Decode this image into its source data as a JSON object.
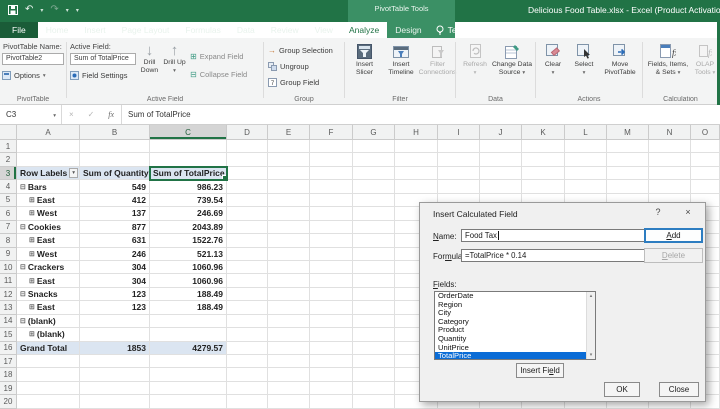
{
  "titlebar": {
    "title": "Delicious Food Table.xlsx - Excel (Product Activation Fa",
    "contextual_label": "PivotTable Tools"
  },
  "tabs": {
    "items": [
      "File",
      "Home",
      "Insert",
      "Page Layout",
      "Formulas",
      "Data",
      "Review",
      "View",
      "Analyze",
      "Design"
    ],
    "active": "Analyze",
    "tellme": "Tell me what you want to do..."
  },
  "ribbon": {
    "pivottable": {
      "name_label": "PivotTable Name:",
      "name_value": "PivotTable2",
      "options": "Options",
      "group_label": "PivotTable"
    },
    "active_field": {
      "label": "Active Field:",
      "value": "Sum of TotalPrice",
      "field_settings": "Field Settings",
      "drill_down": "Drill Down",
      "drill_up": "Drill Up",
      "expand": "Expand Field",
      "collapse": "Collapse Field",
      "group_label": "Active Field"
    },
    "group": {
      "selection": "Group Selection",
      "ungroup": "Ungroup",
      "field": "Group Field",
      "group_label": "Group"
    },
    "filter": {
      "slicer_1": "Insert",
      "slicer_2": "Slicer",
      "timeline_1": "Insert",
      "timeline_2": "Timeline",
      "connections_1": "Filter",
      "connections_2": "Connections",
      "group_label": "Filter"
    },
    "data": {
      "refresh": "Refresh",
      "change_1": "Change Data",
      "change_2": "Source",
      "group_label": "Data"
    },
    "actions": {
      "clear": "Clear",
      "select": "Select",
      "move_1": "Move",
      "move_2": "PivotTable",
      "group_label": "Actions"
    },
    "calculations": {
      "fields_1": "Fields, Items,",
      "fields_2": "& Sets",
      "olap_1": "OLAP",
      "olap_2": "Tools",
      "group_label": "Calculation"
    }
  },
  "formula_bar": {
    "cell_ref": "C3",
    "formula": "Sum of TotalPrice",
    "fx": "fx",
    "cancel": "×",
    "enter": "✓"
  },
  "sheet": {
    "columns": [
      "A",
      "B",
      "C",
      "D",
      "E",
      "F",
      "G",
      "H",
      "I",
      "J",
      "K",
      "L",
      "M",
      "N",
      "O"
    ],
    "row_count": 20,
    "pivot": {
      "header": {
        "row": 3,
        "row_labels": "Row Labels",
        "col_qty": "Sum of Quantity",
        "col_total": "Sum of TotalPrice"
      },
      "selected_cell": "C3",
      "rows": [
        {
          "row": 4,
          "label": "Bars",
          "expand": "minus",
          "level": 0,
          "qty": "549",
          "total": "986.23"
        },
        {
          "row": 5,
          "label": "East",
          "expand": "plus",
          "level": 1,
          "qty": "412",
          "total": "739.54"
        },
        {
          "row": 6,
          "label": "West",
          "expand": "plus",
          "level": 1,
          "qty": "137",
          "total": "246.69"
        },
        {
          "row": 7,
          "label": "Cookies",
          "expand": "minus",
          "level": 0,
          "qty": "877",
          "total": "2043.89"
        },
        {
          "row": 8,
          "label": "East",
          "expand": "plus",
          "level": 1,
          "qty": "631",
          "total": "1522.76"
        },
        {
          "row": 9,
          "label": "West",
          "expand": "plus",
          "level": 1,
          "qty": "246",
          "total": "521.13"
        },
        {
          "row": 10,
          "label": "Crackers",
          "expand": "minus",
          "level": 0,
          "qty": "304",
          "total": "1060.96"
        },
        {
          "row": 11,
          "label": "East",
          "expand": "plus",
          "level": 1,
          "qty": "304",
          "total": "1060.96"
        },
        {
          "row": 12,
          "label": "Snacks",
          "expand": "minus",
          "level": 0,
          "qty": "123",
          "total": "188.49"
        },
        {
          "row": 13,
          "label": "East",
          "expand": "plus",
          "level": 1,
          "qty": "123",
          "total": "188.49"
        },
        {
          "row": 14,
          "label": "(blank)",
          "expand": "minus",
          "level": 0,
          "qty": "",
          "total": ""
        },
        {
          "row": 15,
          "label": "(blank)",
          "expand": "plus",
          "level": 1,
          "qty": "",
          "total": ""
        },
        {
          "row": 16,
          "label": "Grand Total",
          "expand": "",
          "level": 0,
          "qty": "1853",
          "total": "4279.57",
          "type": "total"
        }
      ]
    }
  },
  "dialog": {
    "title": "Insert Calculated Field",
    "help": "?",
    "close_x": "×",
    "name_label": "Name:",
    "name_value": "Food Tax",
    "formula_label": "Formula:",
    "formula_value": "=TotalPrice * 0.14",
    "fields_label": "Fields:",
    "fields": [
      "OrderDate",
      "Region",
      "City",
      "Category",
      "Product",
      "Quantity",
      "UnitPrice",
      "TotalPrice"
    ],
    "selected_field": "TotalPrice",
    "add_button": "Add",
    "delete_button": "Delete",
    "insert_field_button": "Insert Field",
    "ok_button": "OK",
    "close_button": "Close"
  },
  "icons": {
    "dropdown": "▾",
    "drill_down": "↓",
    "drill_up": "↑",
    "undo": "↶",
    "redo": "↷",
    "expand_box": "⊞",
    "collapse_box": "⊟",
    "arrow_right": "→",
    "scroll_up": "▴",
    "scroll_down": "▾"
  },
  "colors": {
    "accent_green": "#217346",
    "selection_blue": "#0a6cd6",
    "pivot_header_blue": "#dbe5f1"
  }
}
